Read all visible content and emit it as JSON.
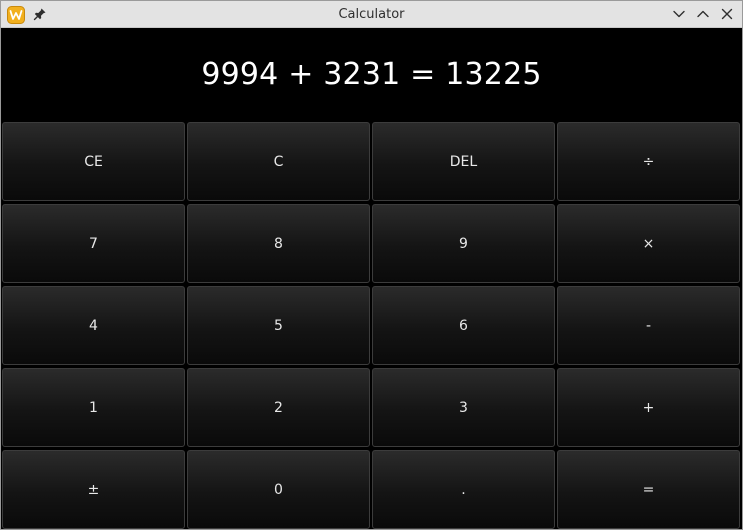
{
  "window": {
    "title": "Calculator"
  },
  "display": {
    "expression": "9994 + 3231 = 13225"
  },
  "keypad": {
    "rows": [
      [
        "CE",
        "C",
        "DEL",
        "÷"
      ],
      [
        "7",
        "8",
        "9",
        "×"
      ],
      [
        "4",
        "5",
        "6",
        "-"
      ],
      [
        "1",
        "2",
        "3",
        "+"
      ],
      [
        "±",
        "0",
        ".",
        "="
      ]
    ]
  },
  "icons": {
    "app": "calculator-app-icon",
    "pin": "pin-icon",
    "minimize": "chevron-down-icon",
    "maximize": "chevron-up-icon",
    "close": "close-icon"
  },
  "colors": {
    "titlebar": "#e3e3e3",
    "background": "#000000",
    "key_text": "#e8e8e8",
    "display_text": "#ffffff",
    "app_icon_accent": "#f2b01e"
  }
}
